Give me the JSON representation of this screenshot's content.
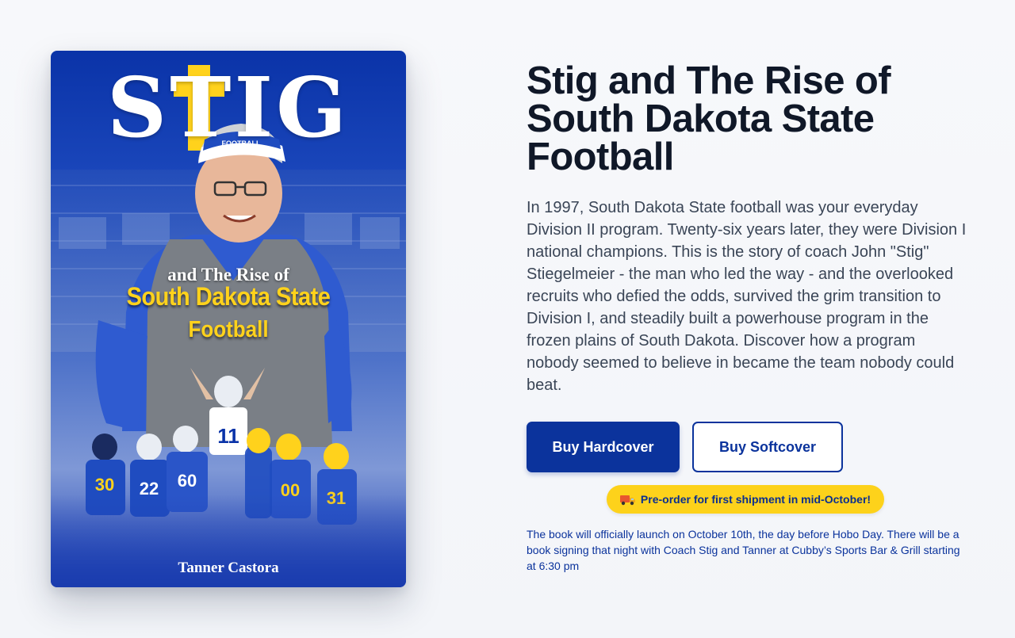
{
  "book": {
    "title": "Stig and The Rise of South Dakota State Football",
    "description": "In 1997, South Dakota State football was your everyday Division II program. Twenty-six years later, they were Division I national champions. This is the story of coach John \"Stig\" Stiegelmeier - the man who led the way - and the overlooked recruits who defied the odds, survived the grim transition to Division I, and steadily built a powerhouse program in the frozen plains of South Dakota. Discover how a program nobody seemed to believe in became the team nobody could beat."
  },
  "cover": {
    "title_word": "STIG",
    "subtitle_line1": "and The Rise of",
    "subtitle_line2": "South Dakota State",
    "subtitle_line3": "Football",
    "author": "Tanner Castora",
    "visor_text": "FOOTBALL",
    "jersey_number_center": "11",
    "jersey_numbers": [
      "30",
      "22",
      "60",
      "00",
      "31"
    ],
    "cross_color": "#ffd21c",
    "background_color": "#0a33a8"
  },
  "actions": {
    "hardcover_label": "Buy Hardcover",
    "softcover_label": "Buy Softcover"
  },
  "preorder_badge": {
    "icon": "delivery-truck-icon",
    "text": "Pre-order for first shipment in mid-October!"
  },
  "launch_note": "The book will officially launch on October 10th, the day before Hobo Day. There will be a book signing that night with Coach Stig and Tanner at Cubby’s Sports Bar & Grill starting at 6:30 pm",
  "colors": {
    "primary": "#0b339c",
    "badge": "#fdd21b",
    "heading": "#101828",
    "body_text": "#3a4556"
  }
}
